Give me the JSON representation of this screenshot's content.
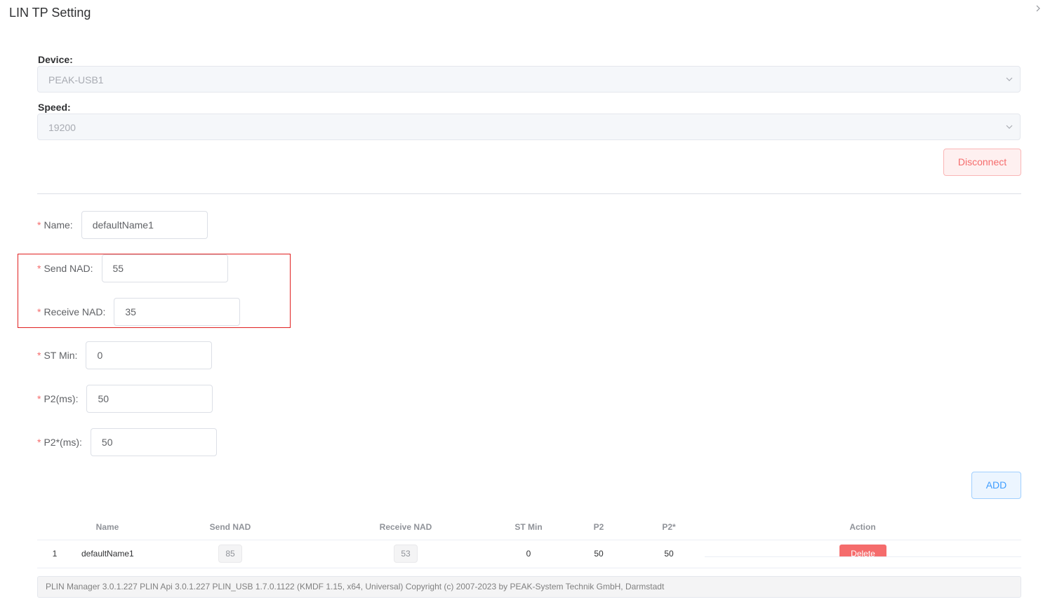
{
  "dialog": {
    "title": "LIN TP Setting",
    "close_icon": "chevron-right-icon"
  },
  "device": {
    "label": "Device:",
    "value": "PEAK-USB1",
    "icon": "chevron-down-icon"
  },
  "speed": {
    "label": "Speed:",
    "value": "19200",
    "icon": "chevron-down-icon"
  },
  "disconnect_label": "Disconnect",
  "form": {
    "required_mark": "*",
    "name": {
      "label": "Name:",
      "value": "defaultName1"
    },
    "send_nad": {
      "label": "Send NAD:",
      "value": "55"
    },
    "receive_nad": {
      "label": "Receive NAD:",
      "value": "35"
    },
    "st_min": {
      "label": "ST Min:",
      "value": "0"
    },
    "p2": {
      "label": "P2(ms):",
      "value": "50"
    },
    "p2_star": {
      "label": "P2*(ms):",
      "value": "50"
    }
  },
  "add_label": "ADD",
  "table": {
    "headers": {
      "name": "Name",
      "send_nad": "Send NAD",
      "receive_nad": "Receive NAD",
      "st_min": "ST Min",
      "p2": "P2",
      "p2_star": "P2*",
      "action": "Action"
    },
    "rows": [
      {
        "index": "1",
        "name": "defaultName1",
        "send_nad": "85",
        "receive_nad": "53",
        "st_min": "0",
        "p2": "50",
        "p2_star": "50",
        "action": "Delete"
      }
    ]
  },
  "footer": "PLIN Manager 3.0.1.227 PLIN Api 3.0.1.227 PLIN_USB 1.7.0.1122 (KMDF 1.15, x64, Universal) Copyright (c) 2007-2023 by PEAK-System Technik GmbH, Darmstadt",
  "colors": {
    "danger": "#f56c6c",
    "primary": "#409eff",
    "highlight_border": "#e02020"
  }
}
